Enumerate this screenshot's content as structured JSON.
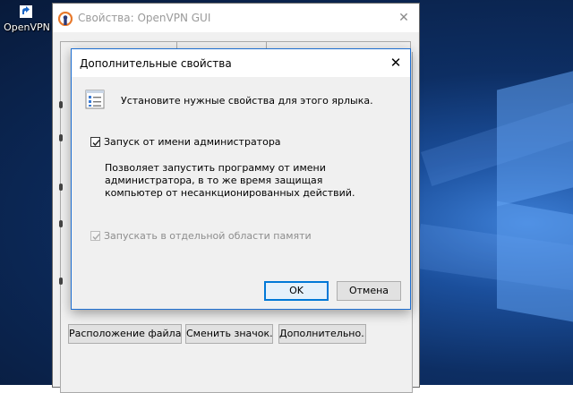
{
  "desktop": {
    "icon_label": "OpenVPN"
  },
  "properties_window": {
    "title": "Свойства: OpenVPN GUI",
    "close_glyph": "✕",
    "buttons": {
      "file_location": "Расположение файла",
      "change_icon": "Сменить значок...",
      "advanced": "Дополнительно..."
    }
  },
  "advanced_dialog": {
    "title": "Дополнительные свойства",
    "close_glyph": "✕",
    "info_text": "Установите нужные свойства для этого ярлыка.",
    "run_as_admin": {
      "label": "Запуск от имени администратора",
      "checked": true
    },
    "description": "Позволяет запустить программу от имени администратора, в то же время защищая компьютер от несанкционированных действий.",
    "separate_memory": {
      "label": "Запускать в отдельной области памяти",
      "checked": true,
      "disabled": true
    },
    "ok_label": "OK",
    "cancel_label": "Отмена"
  },
  "colors": {
    "accent": "#0078d7",
    "desktop_dark": "#081a3a",
    "desktop_light": "#3d7fd6"
  }
}
